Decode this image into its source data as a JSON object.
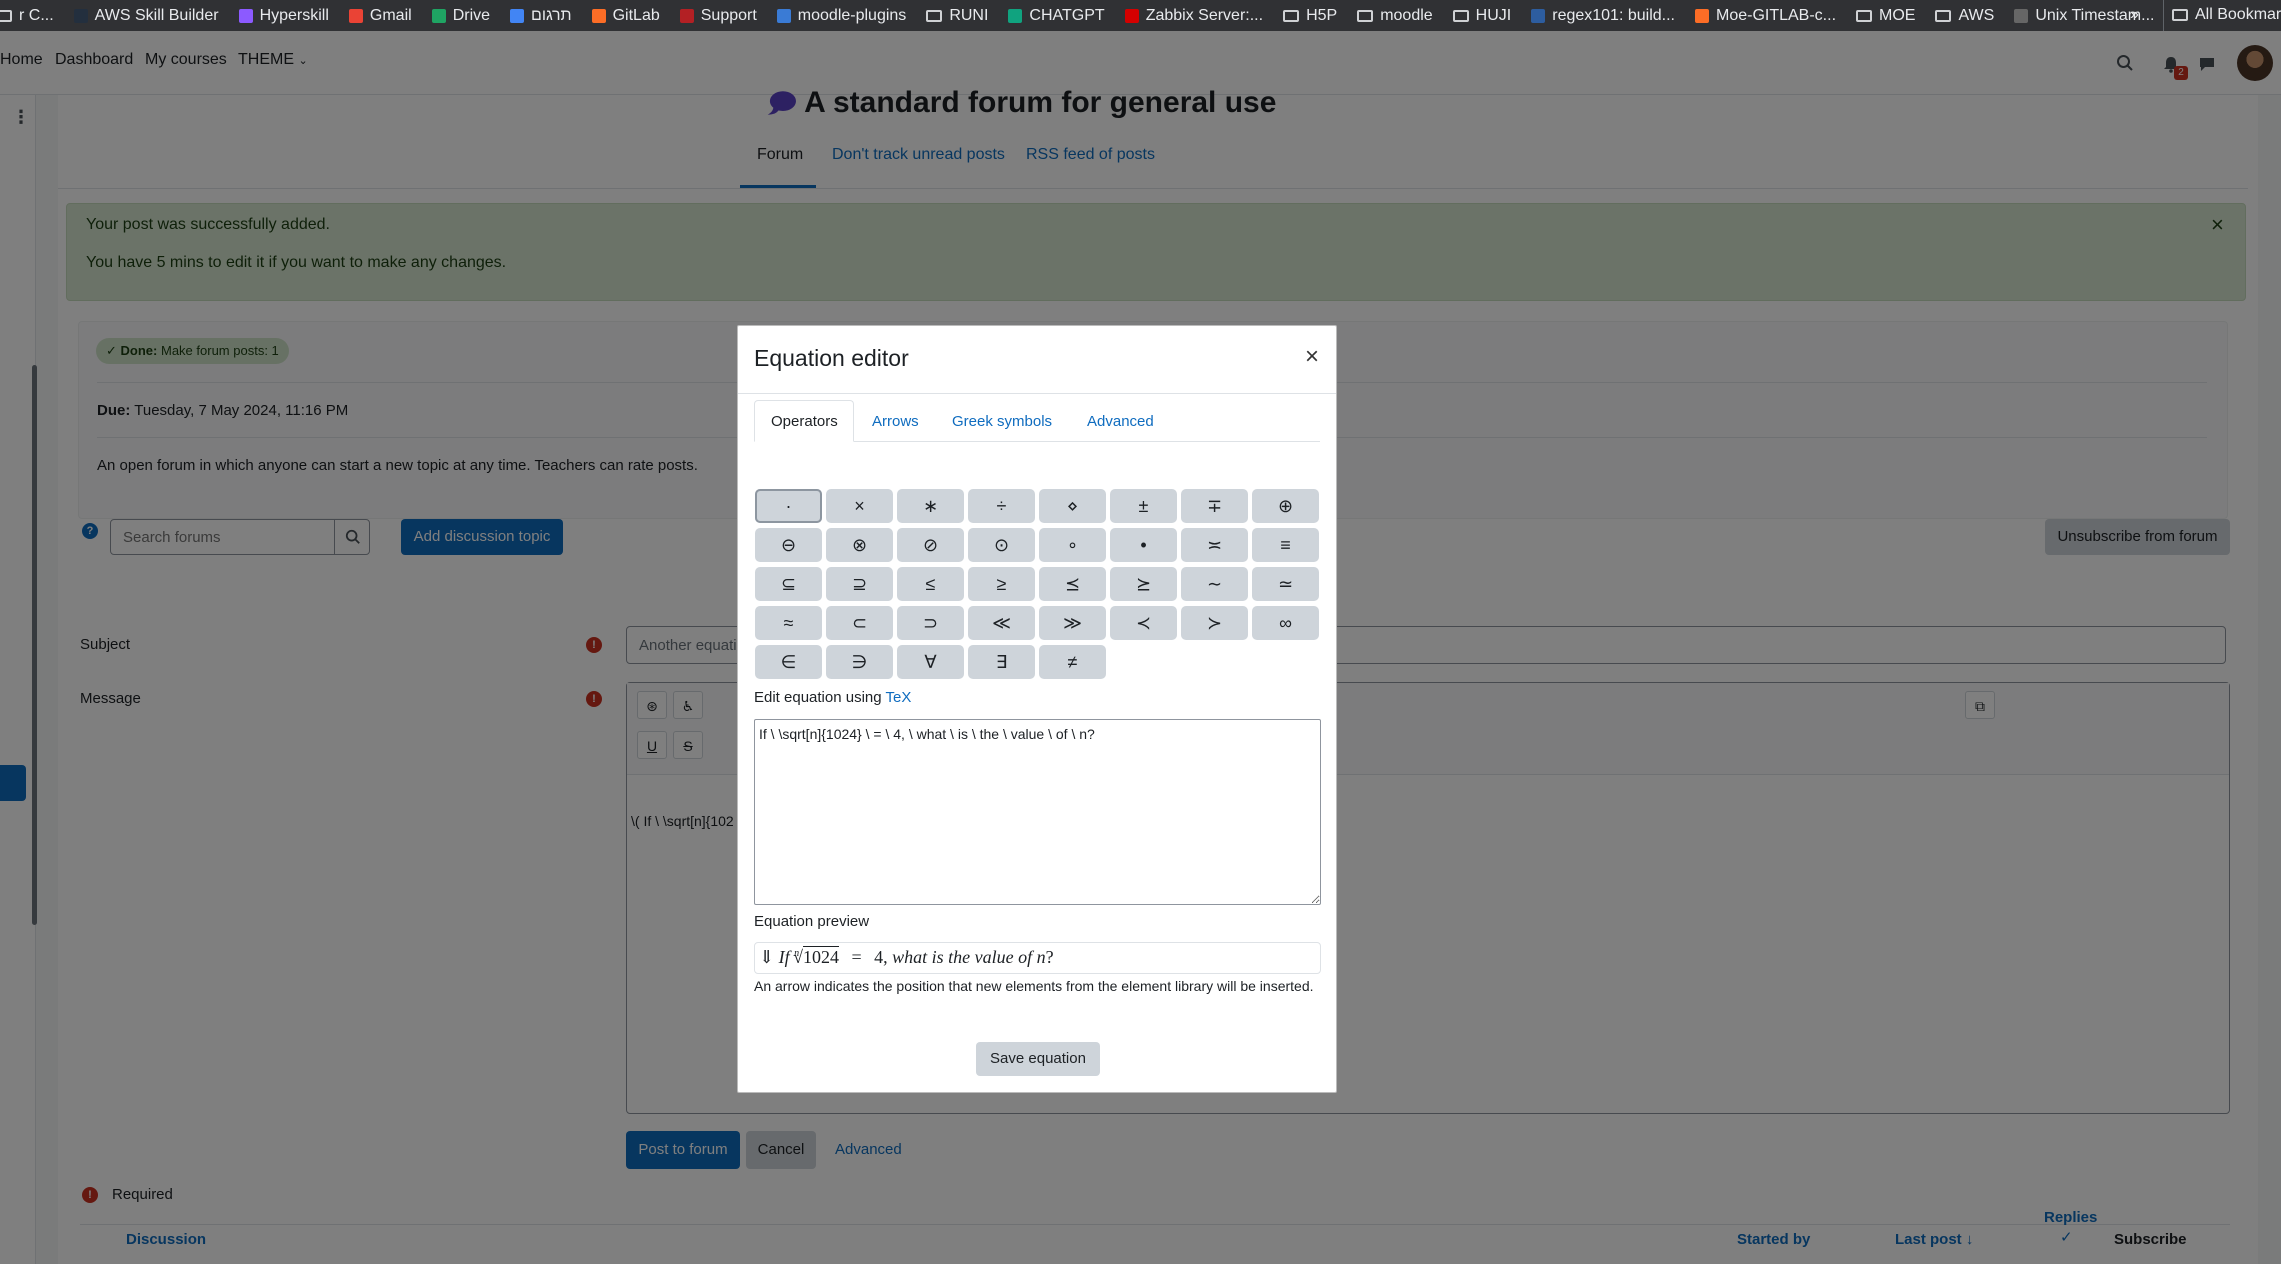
{
  "bookmarks": [
    {
      "label": "r C...",
      "icon": "folder-icon"
    },
    {
      "label": "AWS Skill Builder",
      "icon": "aws-icon"
    },
    {
      "label": "Hyperskill",
      "icon": "hyperskill-icon"
    },
    {
      "label": "Gmail",
      "icon": "gmail-icon"
    },
    {
      "label": "Drive",
      "icon": "drive-icon"
    },
    {
      "label": "תרגום",
      "icon": "google-icon"
    },
    {
      "label": "GitLab",
      "icon": "gitlab-icon"
    },
    {
      "label": "Support",
      "icon": "redmine-icon"
    },
    {
      "label": "moodle-plugins",
      "icon": "moodle-icon"
    },
    {
      "label": "RUNI",
      "icon": "folder-icon"
    },
    {
      "label": "CHATGPT",
      "icon": "chatgpt-icon"
    },
    {
      "label": "Zabbix Server:...",
      "icon": "zabbix-icon"
    },
    {
      "label": "H5P",
      "icon": "folder-icon"
    },
    {
      "label": "moodle",
      "icon": "folder-icon"
    },
    {
      "label": "HUJI",
      "icon": "folder-icon"
    },
    {
      "label": "regex101: build...",
      "icon": "regex-icon"
    },
    {
      "label": "Moe-GITLAB-c...",
      "icon": "gitlab-icon"
    },
    {
      "label": "MOE",
      "icon": "folder-icon"
    },
    {
      "label": "AWS",
      "icon": "folder-icon"
    },
    {
      "label": "Unix Timestam...",
      "icon": "clock-icon"
    }
  ],
  "bookmarks_more": "»",
  "bookmarks_all": "All Bookmarks",
  "nav": {
    "home": "Home",
    "dashboard": "Dashboard",
    "my_courses": "My courses",
    "theme": "THEME"
  },
  "notif_count": "2",
  "page_title": "A standard forum for general use",
  "tabs": {
    "forum": "Forum",
    "dont_track": "Don't track unread posts",
    "rss": "RSS feed of posts"
  },
  "alert": {
    "line1": "Your post was successfully added.",
    "line2": "You have 5 mins to edit it if you want to make any changes.",
    "close": "×"
  },
  "activity": {
    "done_label": "Done:",
    "done_text": "Make forum posts: 1",
    "due_label": "Due:",
    "due_value": "Tuesday, 7 May 2024, 11:16 PM",
    "description": "An open forum in which anyone can start a new topic at any time. Teachers can rate posts."
  },
  "search": {
    "placeholder": "Search forums"
  },
  "buttons": {
    "add_discussion": "Add discussion topic",
    "unsubscribe": "Unsubscribe from forum",
    "post": "Post to forum",
    "cancel": "Cancel",
    "advanced": "Advanced"
  },
  "form": {
    "subject_label": "Subject",
    "subject_value": "Another equati",
    "message_label": "Message",
    "message_preview": "\\( If \\ \\sqrt[n]{102",
    "required": "Required"
  },
  "table": {
    "discussion": "Discussion",
    "started_by": "Started by",
    "last_post": "Last post",
    "last_post_arrow": "↓",
    "replies": "Replies",
    "subscribe": "Subscribe"
  },
  "modal": {
    "title": "Equation editor",
    "close": "×",
    "tabs": [
      "Operators",
      "Arrows",
      "Greek symbols",
      "Advanced"
    ],
    "operators": [
      "·",
      "×",
      "∗",
      "÷",
      "⋄",
      "±",
      "∓",
      "⊕",
      "⊖",
      "⊗",
      "⊘",
      "⊙",
      "∘",
      "•",
      "≍",
      "≡",
      "⊆",
      "⊇",
      "≤",
      "≥",
      "⪯",
      "⪰",
      "∼",
      "≃",
      "≈",
      "⊂",
      "⊃",
      "≪",
      "≫",
      "≺",
      "≻",
      "∞",
      "∈",
      "∋",
      "∀",
      "∃",
      "≠"
    ],
    "edit_label": "Edit equation using",
    "edit_link": "TeX",
    "tex_value": "If \\ \\sqrt[n]{1024} \\ = \\ 4, \\ what \\ is \\ the \\ value \\ of \\ n?",
    "preview_label": "Equation preview",
    "preview": {
      "arrow": "⇓",
      "if": "If",
      "radical": "√",
      "index": "n",
      "radicand": "1024",
      "equals": "=",
      "rhs": "4,",
      "question": "what is the value of",
      "var": "n",
      "qmark": "?"
    },
    "hint": "An arrow indicates the position that new elements from the element library will be inserted.",
    "save": "Save equation"
  },
  "colors": {
    "primary": "#0f6cbf",
    "success_bg": "#d7e6d1",
    "danger": "#ca3120"
  }
}
